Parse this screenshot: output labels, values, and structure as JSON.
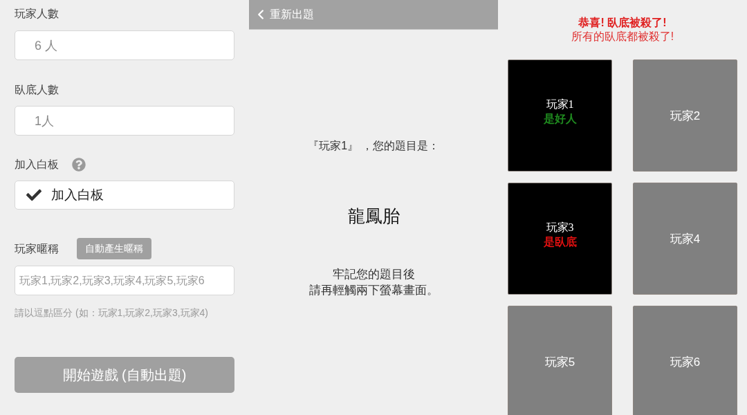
{
  "setup_panel": {
    "player_count": {
      "label": "玩家人數",
      "value": "6 人"
    },
    "spy_count": {
      "label": "臥底人數",
      "value": "1人"
    },
    "blank": {
      "label": "加入白板",
      "option": {
        "label": "加入白板",
        "checked": true
      }
    },
    "nicknames": {
      "label": "玩家暱稱",
      "auto_button": "自動產生暱稱",
      "placeholder": "玩家1,玩家2,玩家3,玩家4,玩家5,玩家6",
      "hint": "請以逗點區分 (如：玩家1,玩家2,玩家3,玩家4)"
    },
    "start_button": "開始遊戲 (自動出題)"
  },
  "topic_panel": {
    "back_button": "重新出題",
    "prompt": "『玩家1』 ，您的題目是：",
    "topic": "龍鳳胎",
    "instruction_lines": [
      "牢記您的題目後",
      "請再輕觸兩下螢幕畫面。"
    ]
  },
  "result_panel": {
    "headline": "恭喜! 臥底被殺了!",
    "subline": "所有的臥底都被殺了!",
    "players": [
      {
        "name": "玩家1",
        "revealed": true,
        "role": "是好人",
        "color": "#1f8a1f"
      },
      {
        "name": "玩家2",
        "revealed": false
      },
      {
        "name": "玩家3",
        "revealed": true,
        "role": "是臥底",
        "color": "#e01010"
      },
      {
        "name": "玩家4",
        "revealed": false
      },
      {
        "name": "玩家5",
        "revealed": false
      },
      {
        "name": "玩家6",
        "revealed": false
      }
    ]
  }
}
